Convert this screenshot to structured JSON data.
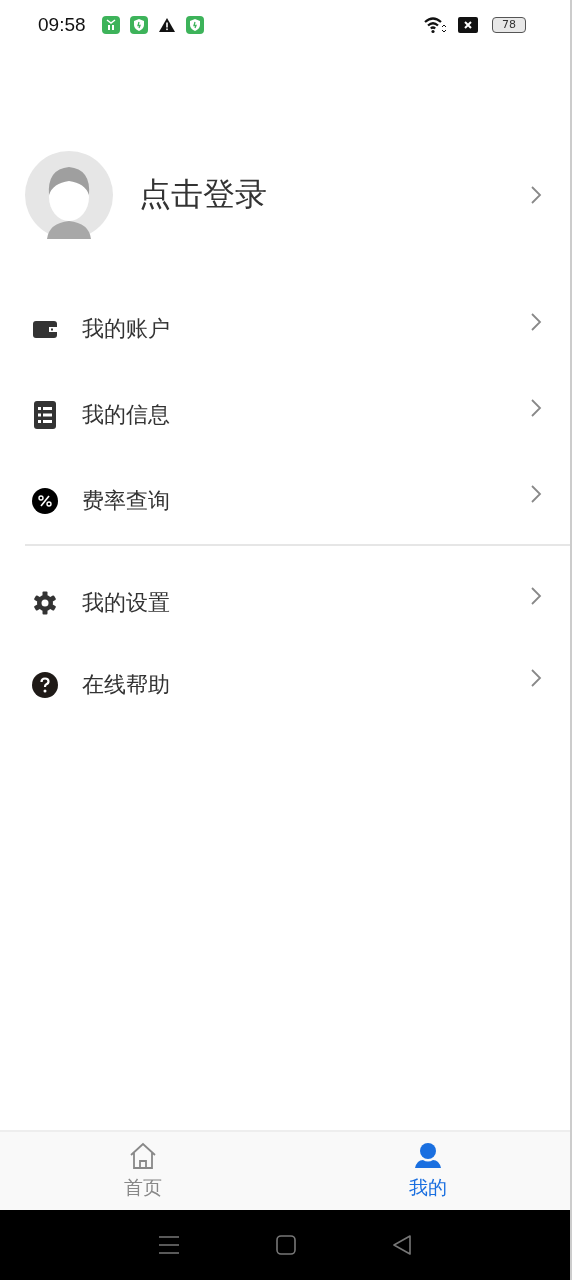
{
  "status_bar": {
    "time": "09:58",
    "battery": "78"
  },
  "profile": {
    "login_label": "点击登录"
  },
  "menu_groups": [
    [
      {
        "kind": "wallet",
        "label": "我的账户"
      },
      {
        "kind": "list",
        "label": "我的信息"
      },
      {
        "kind": "percent",
        "label": "费率查询"
      }
    ],
    [
      {
        "kind": "gear",
        "label": "我的设置"
      },
      {
        "kind": "help",
        "label": "在线帮助"
      }
    ]
  ],
  "tabs": [
    {
      "kind": "home",
      "label": "首页",
      "selected": false
    },
    {
      "kind": "person",
      "label": "我的",
      "selected": true
    }
  ]
}
